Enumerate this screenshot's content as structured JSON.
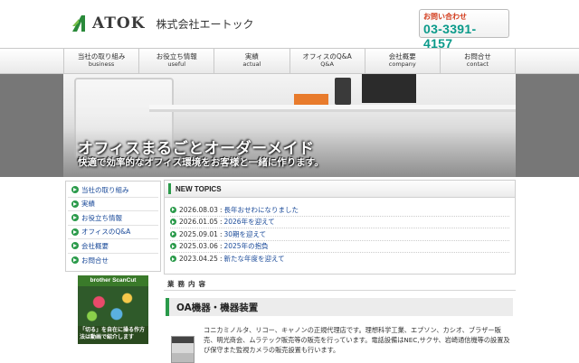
{
  "header": {
    "logo_text": "ATOK",
    "company_name": "株式会社エートック",
    "contact_label": "お問い合わせ",
    "contact_phone": "03-3391-4157"
  },
  "nav": [
    {
      "ja": "当社の取り組み",
      "en": "business"
    },
    {
      "ja": "お役立ち情報",
      "en": "useful"
    },
    {
      "ja": "実績",
      "en": "actual"
    },
    {
      "ja": "オフィスのQ&A",
      "en": "Q&A"
    },
    {
      "ja": "会社概要",
      "en": "company"
    },
    {
      "ja": "お問合せ",
      "en": "contact"
    }
  ],
  "hero": {
    "title": "オフィスまるごとオーダーメイド",
    "subtitle": "快適で効率的なオフィス環境をお客様と一緒に作ります。"
  },
  "sidebar": {
    "items": [
      "当社の取り組み",
      "実績",
      "お役立ち情報",
      "オフィスのQ&A",
      "会社概要",
      "お問合せ"
    ]
  },
  "banner": {
    "title": "brother ScanCut",
    "caption": "「切る」を自在に操る作方法は動画で紹介します"
  },
  "topics": {
    "title": "NEW TOPICS",
    "items": [
      {
        "date": "2026.08.03",
        "text": "長年おせわになりました"
      },
      {
        "date": "2026.01.05",
        "text": "2026年を迎えて"
      },
      {
        "date": "2025.09.01",
        "text": "30期を迎えて"
      },
      {
        "date": "2025.03.06",
        "text": "2025年の抱負"
      },
      {
        "date": "2023.04.25",
        "text": "新たな年度を迎えて"
      }
    ]
  },
  "business": {
    "heading": "業務内容",
    "subheading": "OA機器・機器装置",
    "text": "コニカミノルタ、リコー、キャノンの正規代理店です。理想科学工業、エプソン、カシオ、ブラザー販売、明光商会、ムラテック販売等の販売を行っています。電話設備はNEC,サクサ、岩崎通信機等の設置及び保守また監視カメラの販売設置も行います。"
  },
  "colors": {
    "accent_green": "#2a9a4a",
    "link_blue": "#1a4a99",
    "phone_teal": "#0a9a8a",
    "contact_red": "#d23a1a"
  }
}
